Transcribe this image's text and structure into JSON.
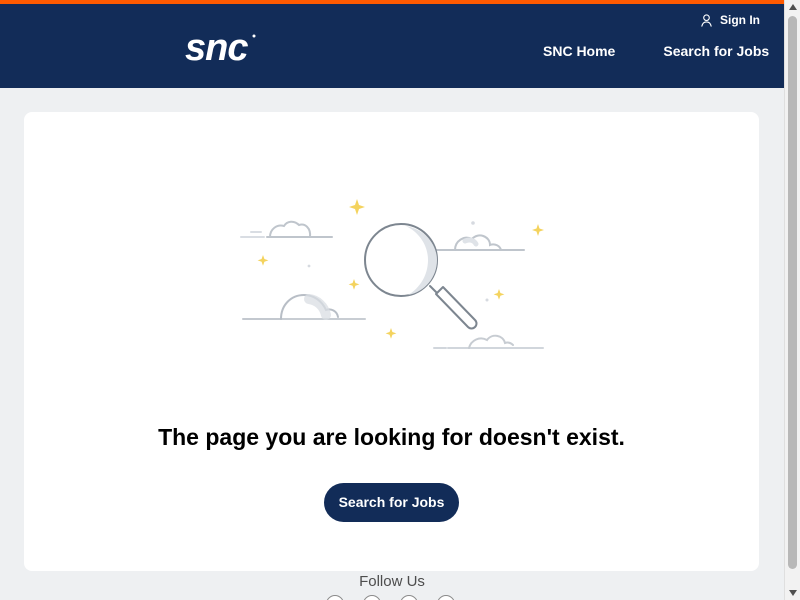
{
  "brand": {
    "logo_text": "SNC",
    "accent_color": "#ff5a00",
    "header_color": "#122c58"
  },
  "header": {
    "sign_in": "Sign In",
    "nav": [
      {
        "label": "SNC Home"
      },
      {
        "label": "Search for Jobs"
      }
    ]
  },
  "main": {
    "message": "The page you are looking for doesn't exist.",
    "button": "Search for Jobs"
  },
  "footer": {
    "follow_title": "Follow Us"
  },
  "icons": {
    "user": "user-icon",
    "illustration": "search-magnifier-illustration",
    "scroll_up": "chevron-up-icon",
    "scroll_down": "chevron-down-icon"
  }
}
